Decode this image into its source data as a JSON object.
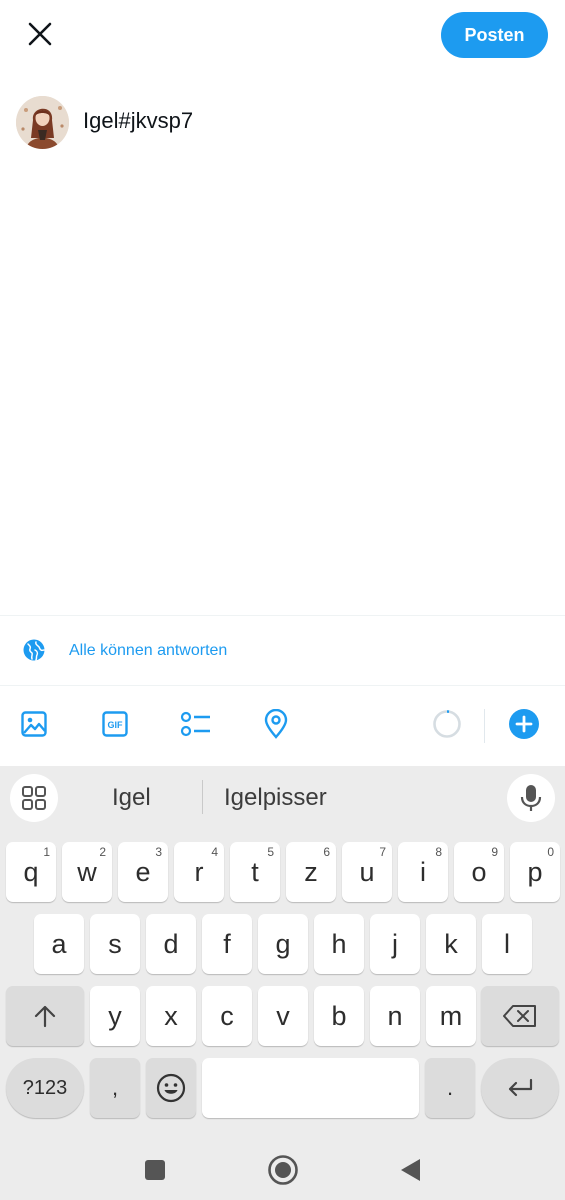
{
  "header": {
    "close_icon": "close-icon",
    "post_label": "Posten",
    "accent": "#1d9bf0"
  },
  "composer": {
    "text": "Igel#jkvsp7",
    "avatar_icon": "avatar"
  },
  "reply_setting": {
    "label": "Alle können antworten",
    "icon": "globe-icon"
  },
  "toolbar": {
    "items": [
      "image-icon",
      "gif-icon",
      "poll-icon",
      "location-icon",
      "character-counter",
      "add-thread-icon"
    ],
    "gif_text": "GIF"
  },
  "keyboard": {
    "suggestions": [
      "Igel",
      "Igelpisser"
    ],
    "row1": [
      {
        "k": "q",
        "h": "1"
      },
      {
        "k": "w",
        "h": "2"
      },
      {
        "k": "e",
        "h": "3"
      },
      {
        "k": "r",
        "h": "4"
      },
      {
        "k": "t",
        "h": "5"
      },
      {
        "k": "z",
        "h": "6"
      },
      {
        "k": "u",
        "h": "7"
      },
      {
        "k": "i",
        "h": "8"
      },
      {
        "k": "o",
        "h": "9"
      },
      {
        "k": "p",
        "h": "0"
      }
    ],
    "row2": [
      "a",
      "s",
      "d",
      "f",
      "g",
      "h",
      "j",
      "k",
      "l"
    ],
    "row3": [
      "y",
      "x",
      "c",
      "v",
      "b",
      "n",
      "m"
    ],
    "symbols_label": "?123",
    "comma": ",",
    "period": "."
  },
  "navbar": {
    "items": [
      "recents-icon",
      "home-icon",
      "back-icon"
    ]
  }
}
